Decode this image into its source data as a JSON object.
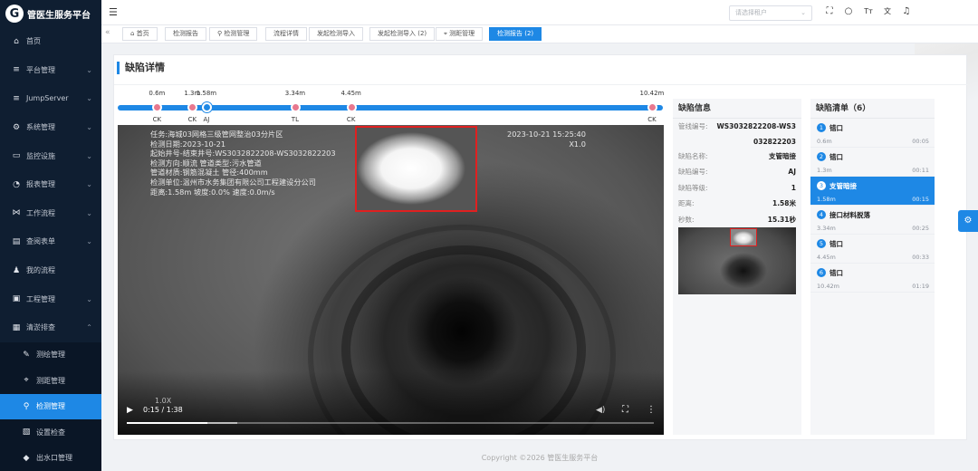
{
  "brand": {
    "logo_letter": "G",
    "title": "管医生服务平台"
  },
  "sidebar": {
    "items": [
      {
        "label": "首页",
        "icon": "home-icon",
        "expandable": false
      },
      {
        "label": "平台管理",
        "icon": "list-icon",
        "expandable": true
      },
      {
        "label": "JumpServer",
        "icon": "list-icon",
        "expandable": true
      },
      {
        "label": "系统管理",
        "icon": "gear-icon",
        "expandable": true
      },
      {
        "label": "监控设施",
        "icon": "monitor-icon",
        "expandable": true
      },
      {
        "label": "报表管理",
        "icon": "chart-icon",
        "expandable": true
      },
      {
        "label": "工作流程",
        "icon": "workflow-icon",
        "expandable": true
      },
      {
        "label": "查阅表单",
        "icon": "form-icon",
        "expandable": true
      },
      {
        "label": "我的流程",
        "icon": "bell-icon",
        "expandable": false
      },
      {
        "label": "工程管理",
        "icon": "project-icon",
        "expandable": true
      },
      {
        "label": "清淤排查",
        "icon": "inspect-icon",
        "expandable": true
      }
    ],
    "subitems": [
      {
        "label": "测绘管理",
        "icon": "pen-icon"
      },
      {
        "label": "测距管理",
        "icon": "crosshair-icon"
      },
      {
        "label": "检测管理",
        "icon": "pin-icon"
      },
      {
        "label": "设置检查",
        "icon": "check-icon"
      },
      {
        "label": "出水口管理",
        "icon": "drop-icon"
      }
    ]
  },
  "header": {
    "tenant_placeholder": "请选择租户",
    "icons": [
      "fullscreen-icon",
      "search-icon",
      "font-size-icon",
      "translate-icon",
      "notification-icon"
    ]
  },
  "tabs": [
    {
      "label": "首页",
      "icon": "⌂"
    },
    {
      "label": "检测报告",
      "icon": ""
    },
    {
      "label": "检测管理",
      "icon": "⚲"
    },
    {
      "label": "流程详情",
      "icon": ""
    },
    {
      "label": "发起检测导入",
      "icon": ""
    },
    {
      "label": "发起检测导入 (2)",
      "icon": ""
    },
    {
      "label": "测距管理",
      "icon": "⌖"
    },
    {
      "label": "检测报告 (2)",
      "icon": "",
      "active": true
    }
  ],
  "page": {
    "title": "缺陷详情"
  },
  "timeline": {
    "total_m": 10.6,
    "points": [
      {
        "dist": "0.6m",
        "m": 0.6,
        "code": "CK"
      },
      {
        "dist": "1.3m",
        "m": 1.3,
        "code": "CK"
      },
      {
        "dist": "1.58m",
        "m": 1.58,
        "code": "AJ",
        "current": true
      },
      {
        "dist": "3.34m",
        "m": 3.34,
        "code": "TL"
      },
      {
        "dist": "4.45m",
        "m": 4.45,
        "code": "CK"
      },
      {
        "dist": "10.42m",
        "m": 10.42,
        "code": "CK"
      }
    ]
  },
  "video": {
    "overlay_lines": [
      "任务:海城03网格三级管网整治03分片区",
      "检测日期:2023-10-21",
      "起始井号-结束井号:WS3032822208-WS3032822203",
      "检测方向:顺流 管道类型:污水管道",
      "管道材质:钢筋混凝土 管径:400mm",
      "检测单位:温州市水务集团有限公司工程建设分公司",
      "距离:1.58m 坡度:0.0% 速度:0.0m/s"
    ],
    "timestamp": "2023-10-21 15:25:40",
    "zoom_top": "X1.0",
    "zoom_bottom": "1.0X",
    "time_readout": "0:15 / 1:38",
    "progress": 0.153,
    "buffered": 0.21
  },
  "defect_info": {
    "title": "缺陷信息",
    "rows": [
      {
        "k": "管线编号:",
        "v": "WS3032822208-WS3"
      },
      {
        "k": "缺陷名称:",
        "v": "支管暗接"
      },
      {
        "k": "缺陷编号:",
        "v": "AJ"
      },
      {
        "k": "缺陷等级:",
        "v": "1"
      },
      {
        "k": "距离:",
        "v": "1.58米"
      },
      {
        "k": "秒数:",
        "v": "15.31秒"
      }
    ],
    "code_continuation": "032822203"
  },
  "defect_list": {
    "title": "缺陷清单（6）",
    "items": [
      {
        "num": "1",
        "name": "错口",
        "dist": "0.6m",
        "time": "00:05"
      },
      {
        "num": "2",
        "name": "错口",
        "dist": "1.3m",
        "time": "00:11"
      },
      {
        "num": "3",
        "name": "支管暗接",
        "dist": "1.58m",
        "time": "00:15",
        "active": true
      },
      {
        "num": "4",
        "name": "接口材料脱落",
        "dist": "3.34m",
        "time": "00:25"
      },
      {
        "num": "5",
        "name": "错口",
        "dist": "4.45m",
        "time": "00:33"
      },
      {
        "num": "6",
        "name": "错口",
        "dist": "10.42m",
        "time": "01:19"
      }
    ]
  },
  "footer": "Copyright ©2026 管医生服务平台",
  "colors": {
    "accent": "#1e88e5",
    "marker": "#e8788e",
    "sidebar_bg": "#0f1e31",
    "defect_box": "#e02020"
  }
}
